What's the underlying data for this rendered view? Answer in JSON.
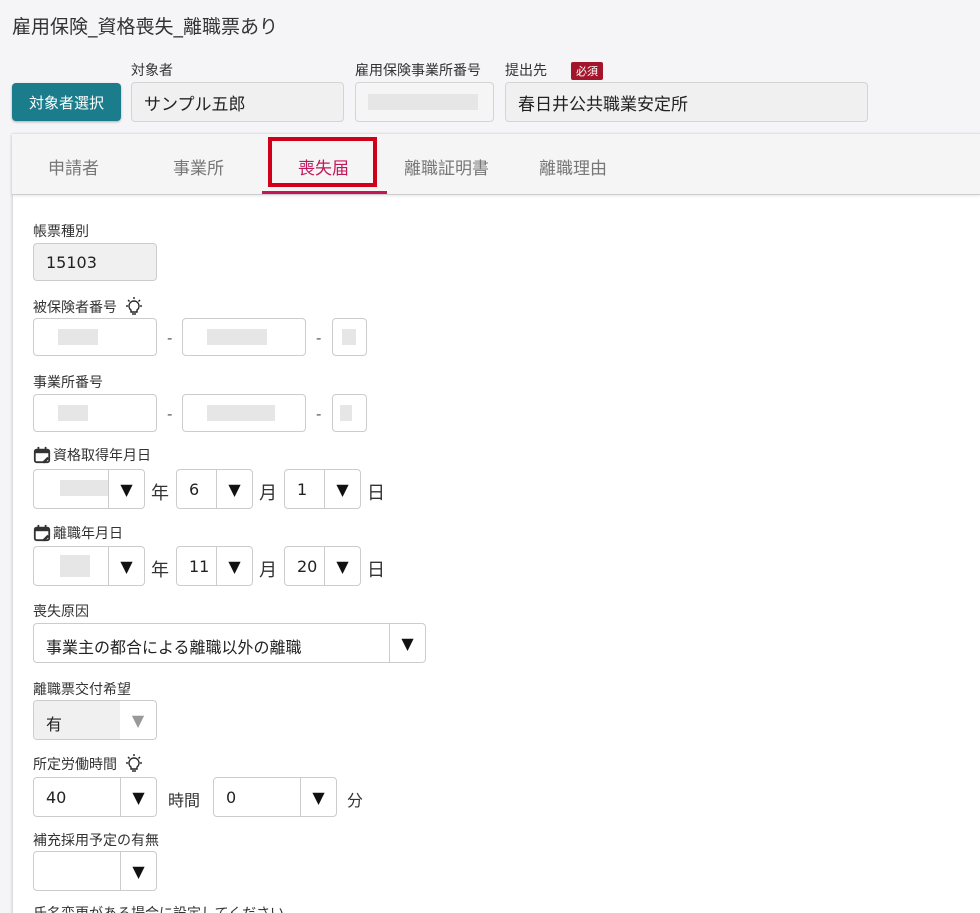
{
  "page_title": "雇用保険_資格喪失_離職票あり",
  "header": {
    "select_button": "対象者選択",
    "subject_label": "対象者",
    "subject_value": "サンプル五郎",
    "office_number_label": "雇用保険事業所番号",
    "submit_to_label": "提出先",
    "required_badge": "必須",
    "submit_to_value": "春日井公共職業安定所"
  },
  "tabs": [
    "申請者",
    "事業所",
    "喪失届",
    "離職証明書",
    "離職理由"
  ],
  "active_tab": "喪失届",
  "form": {
    "form_type_label": "帳票種別",
    "form_type_value": "15103",
    "insured_number_label": "被保険者番号",
    "office_number_label": "事業所番号",
    "dash": "-",
    "acquired_date_label": "資格取得年月日",
    "acquired_month": "6",
    "acquired_day": "1",
    "leave_date_label": "離職年月日",
    "leave_month": "11",
    "leave_day": "20",
    "year_unit": "年",
    "month_unit": "月",
    "day_unit": "日",
    "loss_reason_label": "喪失原因",
    "loss_reason_value": "事業主の都合による離職以外の離職",
    "slip_request_label": "離職票交付希望",
    "slip_request_value": "有",
    "work_hours_label": "所定労働時間",
    "hours_value": "40",
    "hours_unit": "時間",
    "minutes_value": "0",
    "minutes_unit": "分",
    "replacement_label": "補充採用予定の有無",
    "replacement_value": "",
    "name_change_label": "氏名変更がある場合に設定してください"
  },
  "accent_color": "#c2185b",
  "button_color": "#1b7d8c",
  "highlight_color": "#d0001a"
}
